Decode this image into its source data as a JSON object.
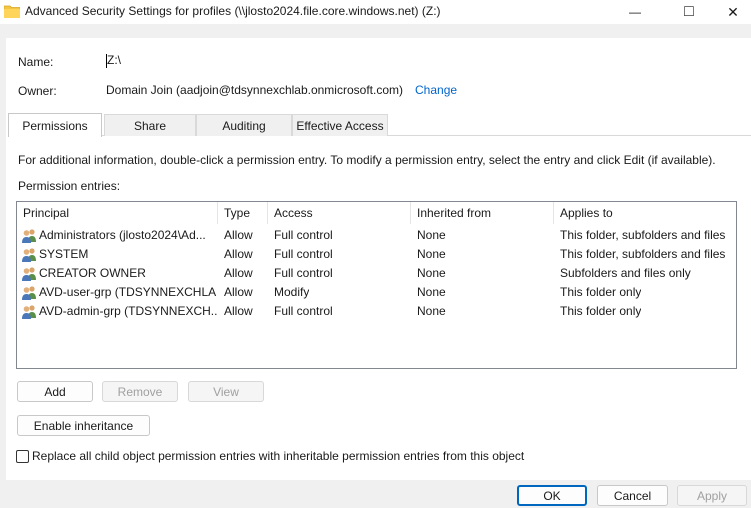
{
  "window": {
    "title": "Advanced Security Settings for profiles (\\\\jlosto2024.file.core.windows.net) (Z:)",
    "minimize_glyph": "—",
    "maximize_glyph": "□",
    "close_glyph": "✕"
  },
  "fields": {
    "name_label": "Name:",
    "name_value": "Z:\\",
    "owner_label": "Owner:",
    "owner_value": "Domain Join (aadjoin@tdsynnexchlab.onmicrosoft.com)",
    "change_link": "Change"
  },
  "tabs": [
    {
      "label": "Permissions",
      "active": true
    },
    {
      "label": "Share",
      "active": false
    },
    {
      "label": "Auditing",
      "active": false
    },
    {
      "label": "Effective Access",
      "active": false
    }
  ],
  "info_text": "For additional information, double-click a permission entry. To modify a permission entry, select the entry and click Edit (if available).",
  "entries_label": "Permission entries:",
  "table": {
    "columns": [
      "Principal",
      "Type",
      "Access",
      "Inherited from",
      "Applies to"
    ],
    "rows": [
      {
        "principal": "Administrators (jlosto2024\\Ad...",
        "type": "Allow",
        "access": "Full control",
        "inherited": "None",
        "applies": "This folder, subfolders and files"
      },
      {
        "principal": "SYSTEM",
        "type": "Allow",
        "access": "Full control",
        "inherited": "None",
        "applies": "This folder, subfolders and files"
      },
      {
        "principal": "CREATOR OWNER",
        "type": "Allow",
        "access": "Full control",
        "inherited": "None",
        "applies": "Subfolders and files only"
      },
      {
        "principal": "AVD-user-grp (TDSYNNEXCHLA...",
        "type": "Allow",
        "access": "Modify",
        "inherited": "None",
        "applies": "This folder only"
      },
      {
        "principal": "AVD-admin-grp (TDSYNNEXCH...",
        "type": "Allow",
        "access": "Full control",
        "inherited": "None",
        "applies": "This folder only"
      }
    ],
    "icon": "user-group-icon"
  },
  "buttons": {
    "add": "Add",
    "remove": "Remove",
    "view": "View",
    "enable_inheritance": "Enable inheritance",
    "ok": "OK",
    "cancel": "Cancel",
    "apply": "Apply"
  },
  "replace_checkbox_label": "Replace all child object permission entries with inheritable permission entries from this object",
  "colors": {
    "link": "#0066cc",
    "accent": "#0067c0",
    "folder": "#f4c542"
  }
}
